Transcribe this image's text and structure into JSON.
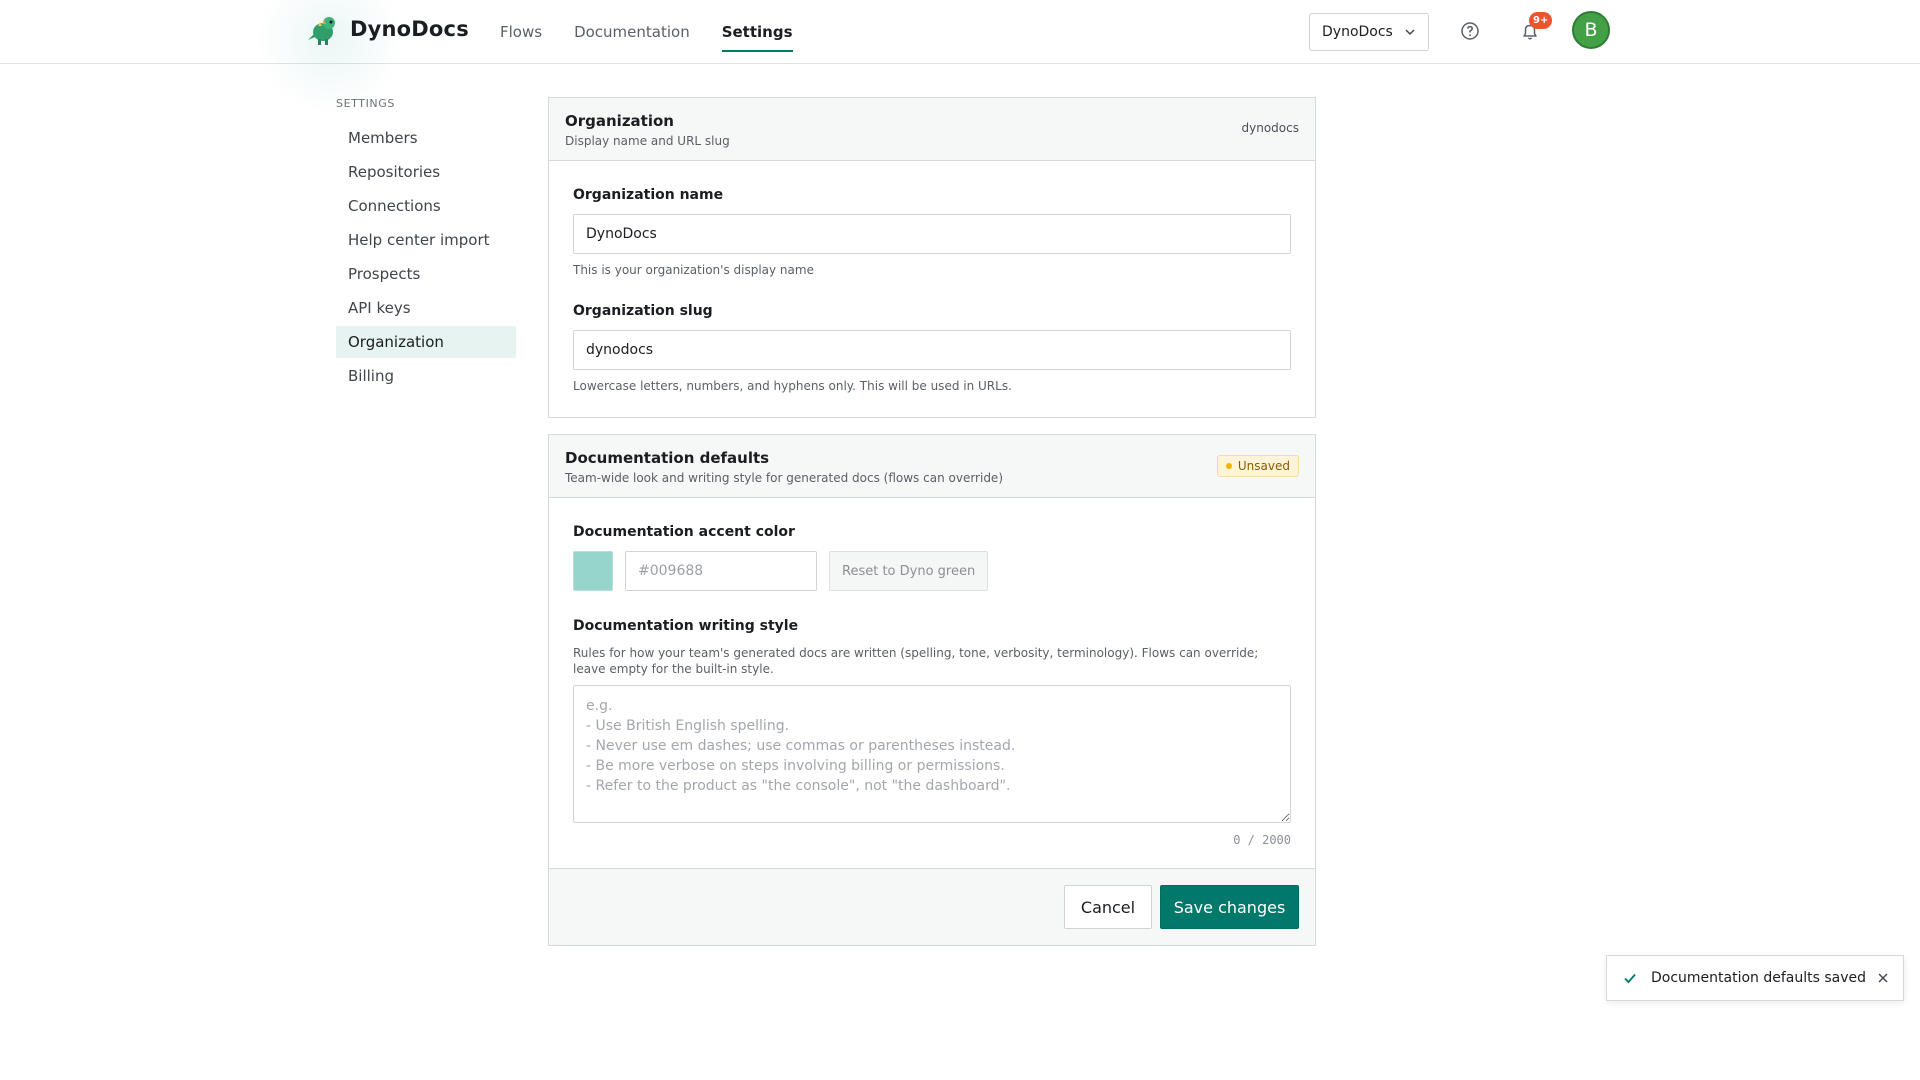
{
  "brand": {
    "name": "DynoDocs"
  },
  "nav": {
    "items": [
      {
        "label": "Flows"
      },
      {
        "label": "Documentation"
      },
      {
        "label": "Settings"
      }
    ]
  },
  "header": {
    "org_selector": "DynoDocs",
    "notifications_badge": "9+",
    "avatar_initial": "B"
  },
  "sidebar": {
    "heading": "SETTINGS",
    "items": [
      {
        "label": "Members"
      },
      {
        "label": "Repositories"
      },
      {
        "label": "Connections"
      },
      {
        "label": "Help center import"
      },
      {
        "label": "Prospects"
      },
      {
        "label": "API keys"
      },
      {
        "label": "Organization"
      },
      {
        "label": "Billing"
      }
    ],
    "active": "Organization"
  },
  "organization": {
    "title": "Organization",
    "subtitle": "Display name and URL slug",
    "meta": "dynodocs",
    "name_label": "Organization name",
    "name_value": "DynoDocs",
    "name_hint": "This is your organization's display name",
    "slug_label": "Organization slug",
    "slug_value": "dynodocs",
    "slug_hint": "Lowercase letters, numbers, and hyphens only. This will be used in URLs."
  },
  "doc_defaults": {
    "title": "Documentation defaults",
    "subtitle": "Team-wide look and writing style for generated docs (flows can override)",
    "status_badge": "Unsaved",
    "accent_label": "Documentation accent color",
    "accent_placeholder": "#009688",
    "accent_swatch_color": "#96d5cc",
    "reset_label": "Reset to Dyno green",
    "style_label": "Documentation writing style",
    "style_hint": "Rules for how your team's generated docs are written (spelling, tone, verbosity, terminology). Flows can override; leave empty for the built-in style.",
    "style_placeholder": "e.g.\n- Use British English spelling.\n- Never use em dashes; use commas or parentheses instead.\n- Be more verbose on steps involving billing or permissions.\n- Refer to the product as \"the console\", not \"the dashboard\".",
    "counter": "0 / 2000",
    "cancel_label": "Cancel",
    "save_label": "Save changes"
  },
  "toast": {
    "message": "Documentation defaults saved"
  },
  "colors": {
    "accent": "#00796b",
    "badge": "#e8552f",
    "avatar": "#43a047"
  },
  "icons": {
    "logo": "dino-logo-icon",
    "dropdown": "chevron-down-icon",
    "help": "help-circle-icon",
    "notifications": "bell-icon",
    "toast_check": "check-icon",
    "toast_close": "close-icon"
  }
}
